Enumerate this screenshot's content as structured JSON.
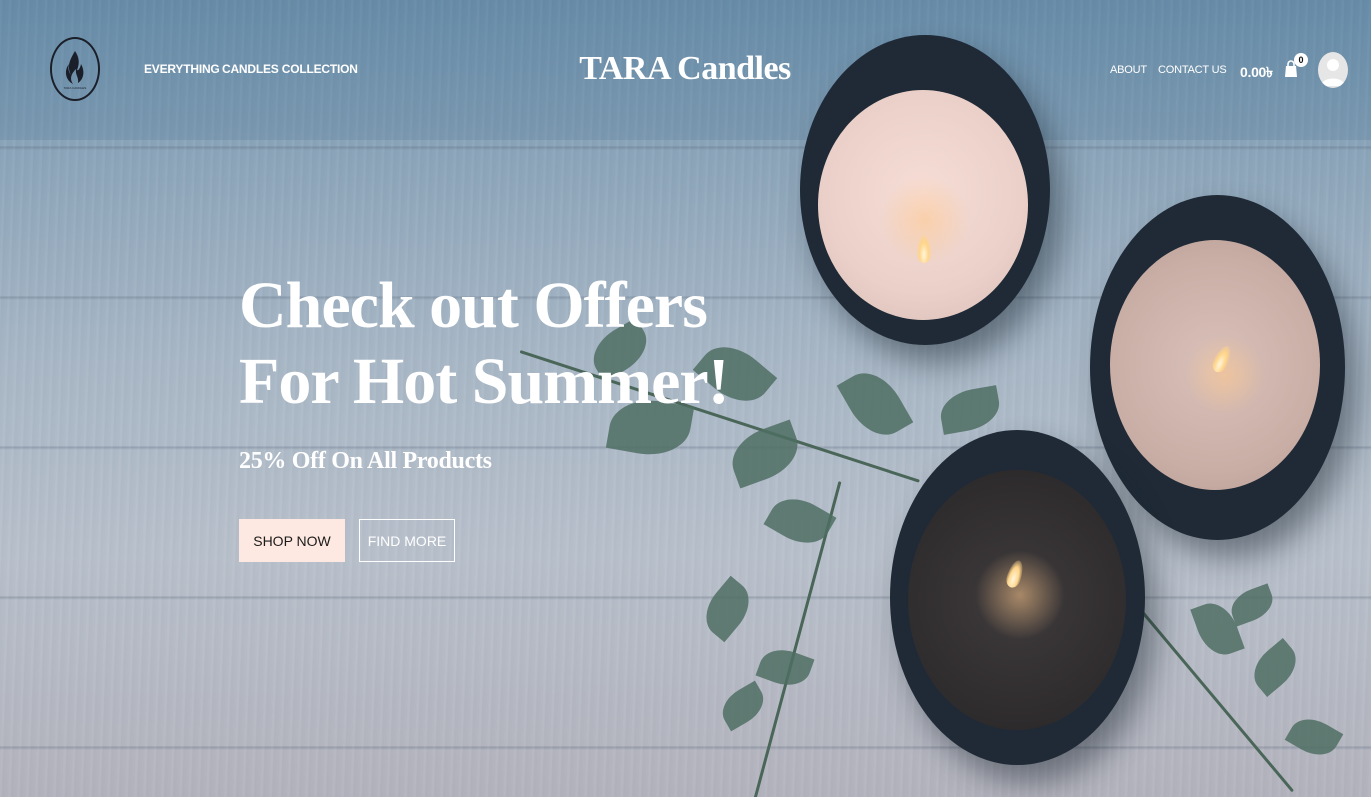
{
  "header": {
    "logo_alt": "TARA Candles logo",
    "nav_left": [
      "EVERYTHING",
      "CANDLES COLLECTION"
    ],
    "brand": "TARA Candles",
    "nav_right": [
      "ABOUT",
      "CONTACT US"
    ],
    "cart_total": "0.00৳",
    "cart_count": "0",
    "icons": {
      "cart": "shopping-bag-icon",
      "avatar": "user-avatar-icon"
    }
  },
  "hero": {
    "headline_line1": "Check out Offers",
    "headline_line2": "For Hot Summer!",
    "subheadline": "25% Off On All Products",
    "buttons": {
      "shop_now": "SHOP NOW",
      "find_more": "FIND MORE"
    }
  },
  "colors": {
    "shop_button_bg": "#fde9e1",
    "text_light": "#ffffff"
  }
}
